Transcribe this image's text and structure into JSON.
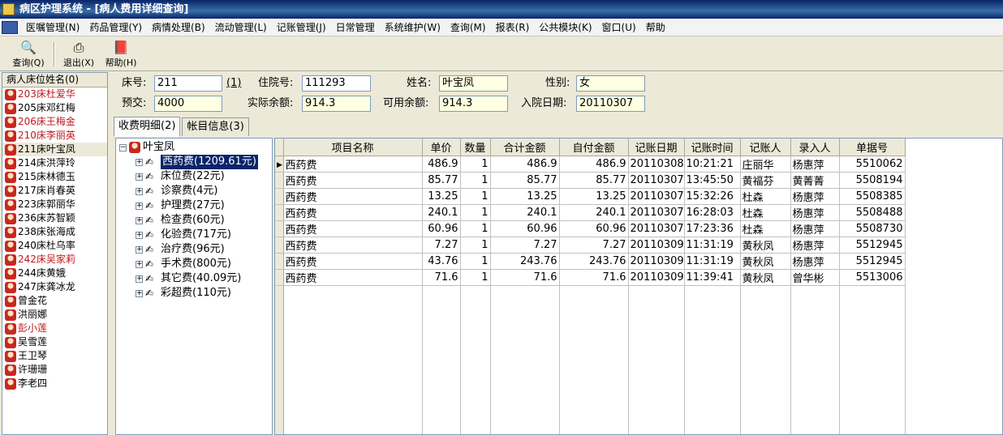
{
  "window": {
    "title": "病区护理系统 - [病人费用详细查询]"
  },
  "menubar": {
    "items": [
      "医嘱管理(N)",
      "药品管理(Y)",
      "病情处理(B)",
      "流动管理(L)",
      "记账管理(J)",
      "日常管理",
      "系统维护(W)",
      "查询(M)",
      "报表(R)",
      "公共模块(K)",
      "窗口(U)",
      "帮助"
    ]
  },
  "toolbar": {
    "query": "查询(Q)",
    "exit": "退出(X)",
    "help": "帮助(H)"
  },
  "patients": {
    "header": "病人床位姓名(0)",
    "items": [
      "203床杜爱华",
      "205床邓红梅",
      "206床王梅金",
      "210床李丽英",
      "211床叶宝凤",
      "214床洪萍玲",
      "215床林德玉",
      "217床肖春英",
      "223床郭丽华",
      "236床苏智颖",
      "238床张海成",
      "240床杜乌率",
      "242床吴家莉",
      "244床黄娥",
      "247床龚冰龙",
      "曾金花",
      "洪丽娜",
      "彭小莲",
      "吴雪莲",
      "王卫琴",
      "许珊珊",
      "李老四"
    ]
  },
  "info": {
    "bed_label": "床号:",
    "bed_value": "211",
    "bed_suffix": "(1)",
    "inpatient_label": "住院号:",
    "inpatient_value": "111293",
    "name_label": "姓名:",
    "name_value": "叶宝凤",
    "gender_label": "性别:",
    "gender_value": "女",
    "prepay_label": "预交:",
    "prepay_value": "4000",
    "balance_label": "实际余额:",
    "balance_value": "914.3",
    "available_label": "可用余额:",
    "available_value": "914.3",
    "admit_label": "入院日期:",
    "admit_value": "20110307"
  },
  "tabs": {
    "fee_detail": "收费明细(2)",
    "account_info": "帐目信息(3)"
  },
  "tree": {
    "root": "叶宝凤",
    "nodes": [
      "西药费(1209.61元)",
      "床位费(22元)",
      "诊察费(4元)",
      "护理费(27元)",
      "检查费(60元)",
      "化验费(717元)",
      "治疗费(96元)",
      "手术费(800元)",
      "其它费(40.09元)",
      "彩超费(110元)"
    ]
  },
  "grid": {
    "columns": [
      "项目名称",
      "单价",
      "数量",
      "合计金额",
      "自付金额",
      "记账日期",
      "记账时间",
      "记账人",
      "录入人",
      "单据号"
    ],
    "rows": [
      [
        "西药费",
        "486.9",
        "1",
        "486.9",
        "486.9",
        "20110308",
        "10:21:21",
        "庄丽华",
        "杨惠萍",
        "5510062"
      ],
      [
        "西药费",
        "85.77",
        "1",
        "85.77",
        "85.77",
        "20110307",
        "13:45:50",
        "黄福芬",
        "黄菁菁",
        "5508194"
      ],
      [
        "西药费",
        "13.25",
        "1",
        "13.25",
        "13.25",
        "20110307",
        "15:32:26",
        "杜森",
        "杨惠萍",
        "5508385"
      ],
      [
        "西药费",
        "240.1",
        "1",
        "240.1",
        "240.1",
        "20110307",
        "16:28:03",
        "杜森",
        "杨惠萍",
        "5508488"
      ],
      [
        "西药费",
        "60.96",
        "1",
        "60.96",
        "60.96",
        "20110307",
        "17:23:36",
        "杜森",
        "杨惠萍",
        "5508730"
      ],
      [
        "西药费",
        "7.27",
        "1",
        "7.27",
        "7.27",
        "20110309",
        "11:31:19",
        "黄秋凤",
        "杨惠萍",
        "5512945"
      ],
      [
        "西药费",
        "43.76",
        "1",
        "243.76",
        "243.76",
        "20110309",
        "11:31:19",
        "黄秋凤",
        "杨惠萍",
        "5512945"
      ],
      [
        "西药费",
        "71.6",
        "1",
        "71.6",
        "71.6",
        "20110309",
        "11:39:41",
        "黄秋凤",
        "曾华彬",
        "5513006"
      ]
    ]
  },
  "colors": {
    "title_bar": "#0a246a",
    "highlight_name": "#c0181c",
    "field_bg": "#ffffe1",
    "selection": "#0a246a"
  }
}
